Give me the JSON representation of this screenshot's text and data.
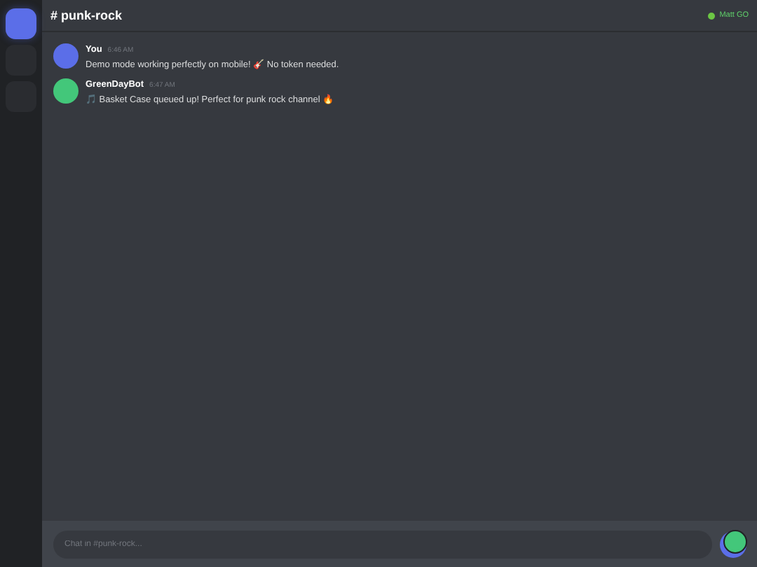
{
  "servers": [
    {
      "selected": true
    },
    {
      "selected": false
    },
    {
      "selected": false
    }
  ],
  "channel": {
    "title": "# punk-rock"
  },
  "user_status": {
    "name": "Matt GO",
    "online": true
  },
  "messages": [
    {
      "author": "You",
      "time": "6:46 AM",
      "text": "Demo mode working perfectly on mobile! 🎸 No token needed.",
      "color": "#5b6ee8"
    },
    {
      "author": "GreenDayBot",
      "time": "6:47 AM",
      "text": "🎵 Basket Case queued up! Perfect for punk rock channel 🔥",
      "color": "#43c77a"
    }
  ],
  "composer": {
    "placeholder": "Chat in #punk-rock..."
  }
}
